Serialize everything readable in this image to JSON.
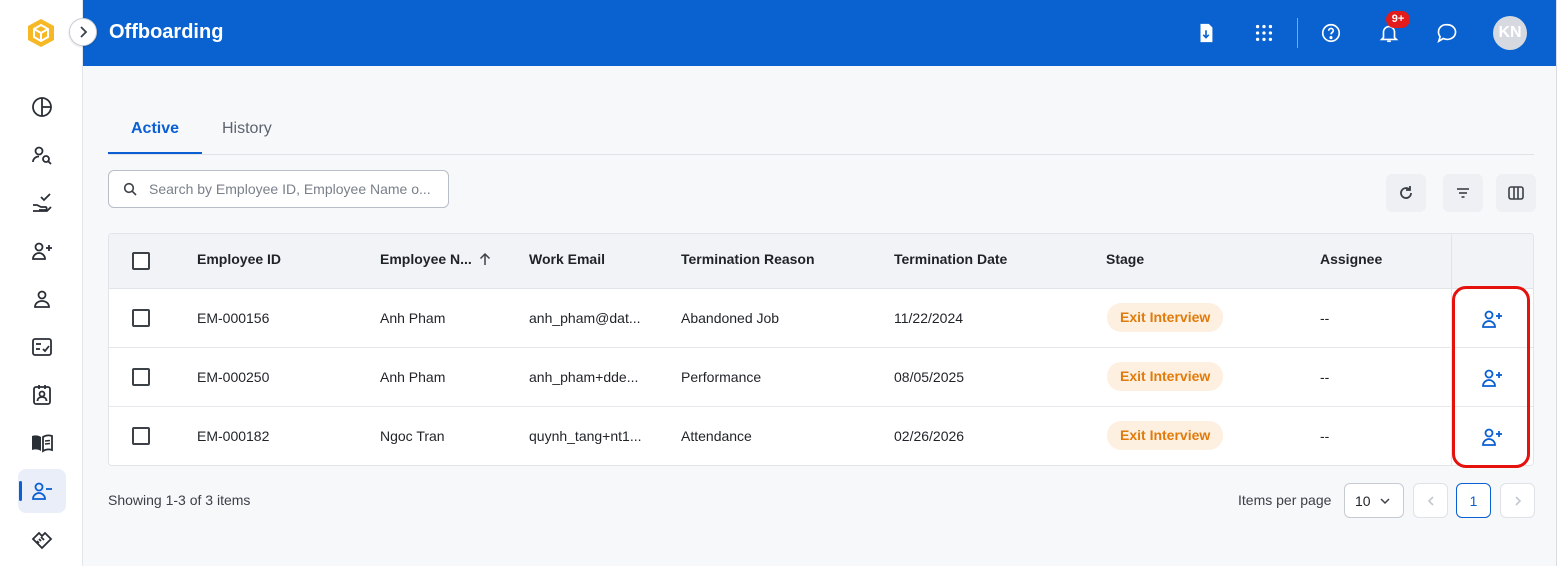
{
  "header": {
    "title": "Offboarding",
    "notification_count": "9+",
    "avatar_initials": "KN"
  },
  "tabs": [
    {
      "label": "Active",
      "active": true
    },
    {
      "label": "History",
      "active": false
    }
  ],
  "search": {
    "placeholder": "Search by Employee ID, Employee Name o..."
  },
  "table": {
    "columns": [
      "Employee ID",
      "Employee N...",
      "Work Email",
      "Termination Reason",
      "Termination Date",
      "Stage",
      "Assignee"
    ],
    "sort": {
      "column": "Employee N...",
      "direction": "ascending"
    },
    "rows": [
      {
        "employee_id": "EM-000156",
        "employee_name": "Anh Pham",
        "work_email": "anh_pham@dat...",
        "termination_reason": "Abandoned Job",
        "termination_date": "11/22/2024",
        "stage": "Exit Interview",
        "assignee": "--"
      },
      {
        "employee_id": "EM-000250",
        "employee_name": "Anh Pham",
        "work_email": "anh_pham+dde...",
        "termination_reason": "Performance",
        "termination_date": "08/05/2025",
        "stage": "Exit Interview",
        "assignee": "--"
      },
      {
        "employee_id": "EM-000182",
        "employee_name": "Ngoc Tran",
        "work_email": "quynh_tang+nt1...",
        "termination_reason": "Attendance",
        "termination_date": "02/26/2026",
        "stage": "Exit Interview",
        "assignee": "--"
      }
    ]
  },
  "footer": {
    "showing": "Showing 1-3 of 3 items",
    "items_per_page_label": "Items per page",
    "items_per_page": "10",
    "current_page": "1"
  },
  "sidebar": {
    "items": [
      "dashboard-icon",
      "user-search-icon",
      "task-hand-icon",
      "user-add-icon",
      "user-icon",
      "checklist-icon",
      "badge-icon",
      "book-icon",
      "user-remove-icon",
      "handshake-icon"
    ],
    "active_item": "user-remove-icon"
  },
  "colors": {
    "brand": "#0a62d0",
    "accent": "#0a5fd3",
    "stage_badge_bg": "#fdf0e1",
    "stage_badge_text": "#e07b0c",
    "highlight": "#e4110d"
  }
}
